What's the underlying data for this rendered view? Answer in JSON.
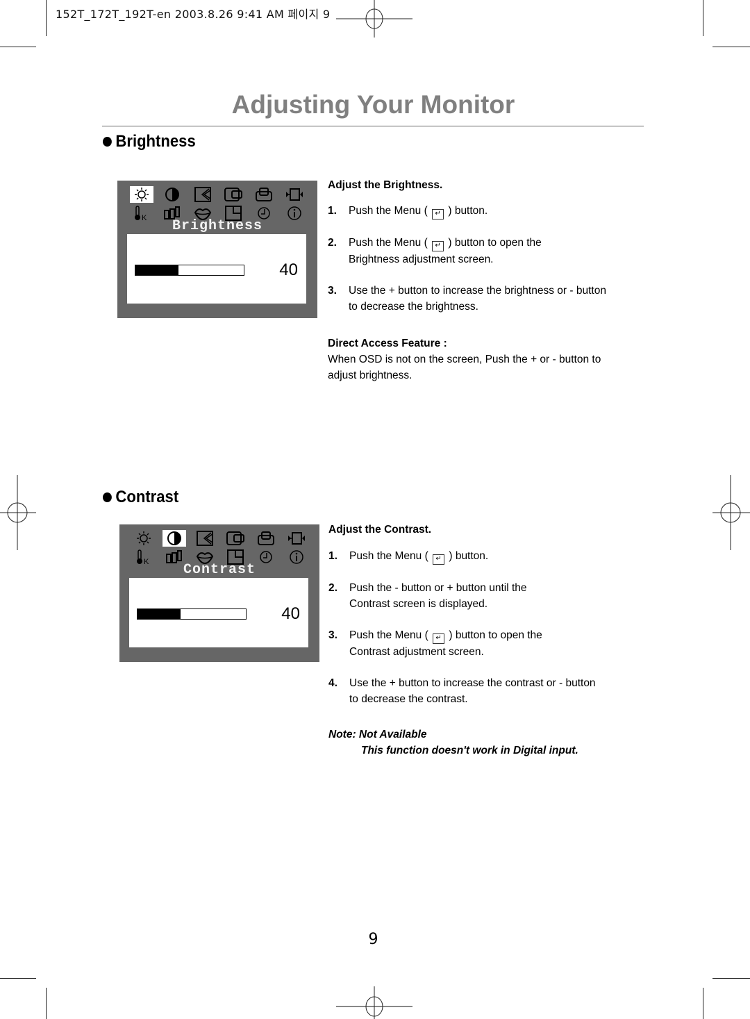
{
  "print_slug": "152T_172T_192T-en  2003.8.26 9:41 AM 페이지 9",
  "page_title": "Adjusting Your Monitor",
  "page_number": "9",
  "osd_icons": [
    "brightness-sun-icon",
    "contrast-half-circle-icon",
    "phase-icon",
    "h-position-icon",
    "v-position-icon",
    "h-size-icon",
    "color-temperature-icon",
    "color-bars-icon",
    "language-lips-icon",
    "osd-position-icon",
    "osd-timer-clock-icon",
    "information-icon"
  ],
  "sections": {
    "brightness": {
      "heading": "Brightness",
      "osd": {
        "label": "Brightness",
        "selected_icon_index": 0,
        "value": "40",
        "level_percent": 40
      },
      "subhead": "Adjust the Brightness.",
      "steps": [
        {
          "num": "1",
          "text_before": "Push the Menu (",
          "text_after": ") button.",
          "has_key": true
        },
        {
          "num": "2",
          "text_before": "Push the Menu (",
          "text_after": ") button to open the",
          "has_key": true,
          "line2": "Brightness adjustment  screen."
        },
        {
          "num": "3",
          "text_before": "Use the + button to increase the brightness or - button",
          "text_after": "",
          "has_key": false,
          "line2": "to decrease the brightness."
        }
      ],
      "direct_access": {
        "heading": "Direct Access Feature :",
        "line1": "When OSD is not on the screen, Push the + or - button to",
        "line2": "adjust brightness."
      }
    },
    "contrast": {
      "heading": "Contrast",
      "osd": {
        "label": "Contrast",
        "selected_icon_index": 1,
        "value": "40",
        "level_percent": 40
      },
      "subhead": "Adjust the Contrast.",
      "steps": [
        {
          "num": "1",
          "text_before": "Push the Menu (",
          "text_after": ") button.",
          "has_key": true
        },
        {
          "num": "2",
          "text_before": "Push the - button or + button until the",
          "text_after": "",
          "has_key": false,
          "line2": "Contrast screen is displayed."
        },
        {
          "num": "3",
          "text_before": "Push the Menu (",
          "text_after": ") button to open the",
          "has_key": true,
          "line2": "Contrast adjustment screen."
        },
        {
          "num": "4",
          "text_before": "Use the + button to increase the contrast or - button",
          "text_after": "",
          "has_key": false,
          "line2": "to decrease the contrast."
        }
      ],
      "note": {
        "heading": "Note: Not Available",
        "text": "This function doesn't work in Digital input."
      }
    }
  }
}
